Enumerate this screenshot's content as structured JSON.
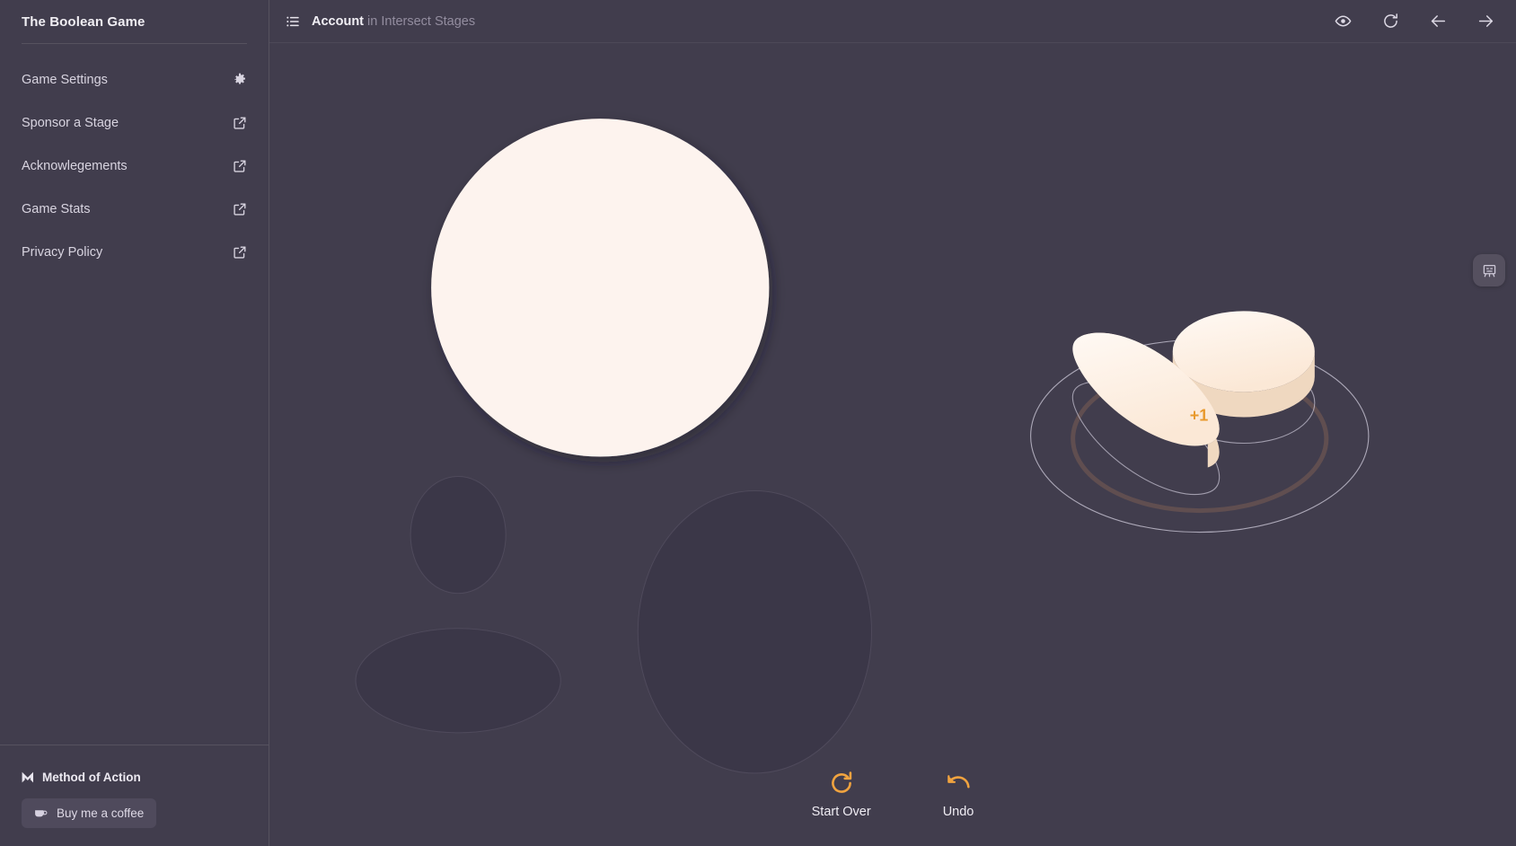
{
  "app": {
    "title": "The Boolean Game",
    "bg_color": "#413d4d",
    "accent_color": "#f0a33f",
    "shape_fill": "#fdf2ea"
  },
  "sidebar": {
    "brand": "The Boolean Game",
    "items": [
      {
        "label": "Game Settings",
        "icon": "gear-icon"
      },
      {
        "label": "Sponsor a Stage",
        "icon": "external-link-icon"
      },
      {
        "label": "Acknowlegements",
        "icon": "external-link-icon"
      },
      {
        "label": "Game Stats",
        "icon": "external-link-icon"
      },
      {
        "label": "Privacy Policy",
        "icon": "external-link-icon"
      }
    ],
    "footer": {
      "brand_mark": "method-of-action-logo",
      "brand_label": "Method of Action",
      "coffee_icon": "coffee-cup-icon",
      "coffee_label": "Buy me a coffee"
    }
  },
  "topbar": {
    "menu_icon": "list-icon",
    "stage_name": "Account",
    "stage_context": "in Intersect Stages",
    "actions": [
      {
        "name": "preview-button",
        "icon": "eye-icon"
      },
      {
        "name": "reset-button",
        "icon": "refresh-icon"
      },
      {
        "name": "previous-button",
        "icon": "arrow-left-icon"
      },
      {
        "name": "next-button",
        "icon": "arrow-right-icon"
      }
    ]
  },
  "stage": {
    "target_shape": {
      "name": "target-circle",
      "type": "circle",
      "fill": "#fdf3ee"
    },
    "operand_shapes": [
      {
        "name": "operand-small-circle",
        "type": "circle"
      },
      {
        "name": "operand-wide-ellipse",
        "type": "ellipse"
      },
      {
        "name": "operand-large-circle",
        "type": "circle"
      }
    ],
    "result_preview": {
      "name": "result-preview",
      "score_badge": "+1",
      "score_color": "#e8992c",
      "pieces": [
        {
          "name": "result-lens-solid",
          "type": "lens"
        },
        {
          "name": "result-disc-solid",
          "type": "disc"
        }
      ]
    }
  },
  "fab": {
    "name": "assistant-button",
    "icon": "robot-icon"
  },
  "controls": [
    {
      "name": "start-over-button",
      "icon": "refresh-icon",
      "label": "Start Over"
    },
    {
      "name": "undo-button",
      "icon": "undo-arrow-icon",
      "label": "Undo"
    }
  ]
}
